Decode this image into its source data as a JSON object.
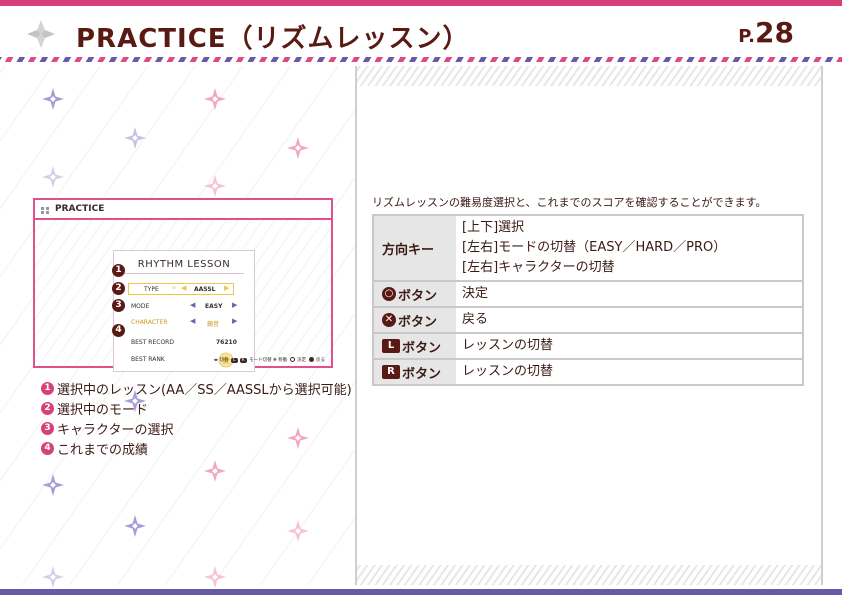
{
  "header": {
    "title": "PRACTICE（リズムレッスン）",
    "page_prefix": "P.",
    "page_number": "28"
  },
  "screenshot": {
    "title": "PRACTICE",
    "card_title": "RHYTHM LESSON",
    "type_label": "TYPE",
    "type_value": "AASSL",
    "mode_label": "MODE",
    "mode_value": "EASY",
    "character_label": "CHARACTER",
    "character_value": "鏡音",
    "best_record_label": "BEST RECORD",
    "best_record_value": "76210",
    "best_rank_label": "BEST RANK",
    "footer": {
      "switch": "切替",
      "mode_switch": "モード切替",
      "move": "移動",
      "decide": "決定",
      "back": "戻る"
    }
  },
  "legend": [
    {
      "num": "1",
      "text": "選択中のレッスン(AA／SS／AASSLから選択可能)"
    },
    {
      "num": "2",
      "text": "選択中のモード"
    },
    {
      "num": "3",
      "text": "キャラクターの選択"
    },
    {
      "num": "4",
      "text": "これまでの成績"
    }
  ],
  "intro": "リズムレッスンの難易度選択と、これまでのスコアを確認することができます。",
  "controls": [
    {
      "key_icon": "",
      "key": "方向キー",
      "lines": [
        "[上下]選択",
        "[左右]モードの切替（EASY／HARD／PRO）",
        "[左右]キャラクターの切替"
      ]
    },
    {
      "key_icon": "○",
      "key": "ボタン",
      "lines": [
        "決定"
      ]
    },
    {
      "key_icon": "✕",
      "key": "ボタン",
      "lines": [
        "戻る"
      ]
    },
    {
      "key_icon": "L",
      "key": "ボタン",
      "lines": [
        "レッスンの切替"
      ]
    },
    {
      "key_icon": "R",
      "key": "ボタン",
      "lines": [
        "レッスンの切替"
      ]
    }
  ],
  "colors": {
    "accent_pink": "#d8407a",
    "accent_purple": "#6a58a8",
    "title_brown": "#5a1a14"
  }
}
